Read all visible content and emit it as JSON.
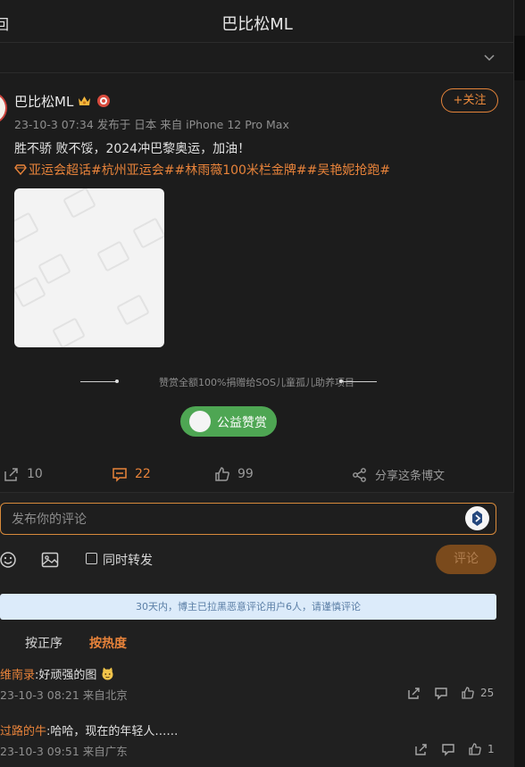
{
  "header": {
    "back_label": "回",
    "title": "巴比松ML"
  },
  "post": {
    "author": "巴比松ML",
    "follow_label": "+关注",
    "meta": "23-10-3 07:34 发布于 日本 来自 iPhone 12 Pro Max",
    "text": "胜不骄 败不馁，2024冲巴黎奥运，加油！",
    "tags": "亚运会超话#杭州亚运会##林雨薇100米栏金牌##吴艳妮抢跑#"
  },
  "reward": {
    "text": "赞赏全额100%捐赠给SOS儿童孤儿助养项目",
    "button_label": "公益赞赏"
  },
  "actions": {
    "repost_count": "10",
    "comment_count": "22",
    "like_count": "99",
    "share_label": "分享这条博文"
  },
  "composer": {
    "placeholder": "发布你的评论",
    "repost_label": "同时转发",
    "submit_label": "评论"
  },
  "notice": "30天内，博主已拉黑恶意评论用户6人，请谨慎评论",
  "sort": {
    "by_time": "按正序",
    "by_hot": "按热度"
  },
  "comments": [
    {
      "user": "维南录",
      "text": ":好顽强的图",
      "meta": "23-10-3 08:21 来自北京",
      "likes": "25"
    },
    {
      "user": "过路的牛",
      "text": ":哈哈，现在的年轻人……",
      "meta": "23-10-3 09:51 来自广东",
      "likes": "1"
    }
  ],
  "colors": {
    "accent": "#e8833a",
    "background": "#1c1c1c",
    "donate_green": "#4ea653"
  }
}
